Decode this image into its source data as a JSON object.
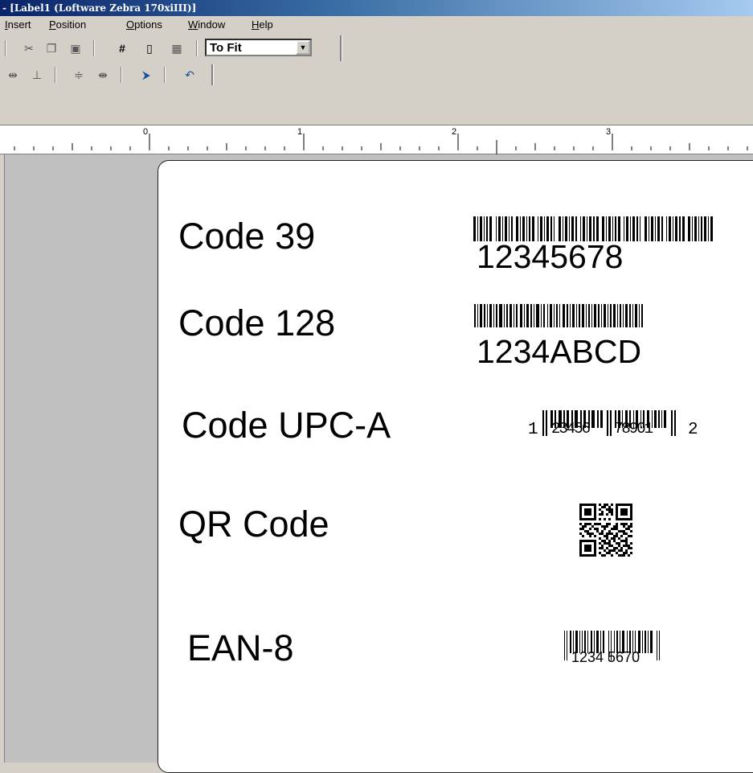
{
  "window": {
    "title": "- [Label1 (Loftware Zebra 170xiIII)]"
  },
  "menu": {
    "items": [
      "Insert",
      "Position",
      "Options",
      "Window",
      "Help"
    ]
  },
  "toolbar": {
    "zoom_value": "To Fit",
    "icons": [
      "cut-icon",
      "copy-icon",
      "paste-icon",
      "grid-icon",
      "page-icon",
      "barcode-icon",
      "align-h-icon",
      "align-v-icon",
      "center-v-icon",
      "center-h-icon",
      "rotate-icon",
      "undo-icon"
    ]
  },
  "ruler": {
    "labels": [
      "0",
      "1",
      "2",
      "3"
    ]
  },
  "label": {
    "rows": [
      {
        "name": "Code 39",
        "barcode_text": "12345678"
      },
      {
        "name": "Code 128",
        "barcode_text": "1234ABCD"
      },
      {
        "name": "Code UPC-A",
        "upc_left": "1",
        "upc_mid1": "23456",
        "upc_mid2": "78901",
        "upc_right": "2"
      },
      {
        "name": "QR Code"
      },
      {
        "name": "EAN-8",
        "ean_text": "1234 5670"
      }
    ]
  }
}
